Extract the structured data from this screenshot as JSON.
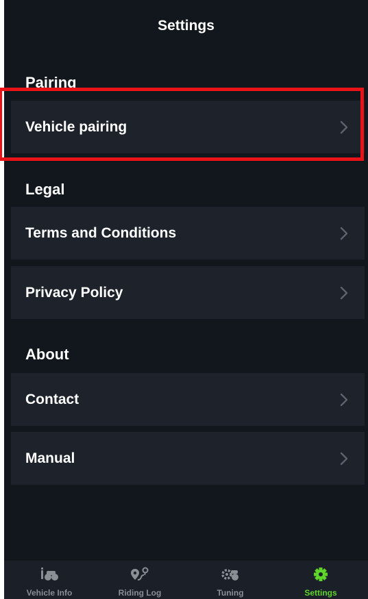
{
  "header": {
    "title": "Settings"
  },
  "sections": {
    "pairing": {
      "heading": "Pairing",
      "items": [
        {
          "label": "Vehicle pairing"
        }
      ]
    },
    "legal": {
      "heading": "Legal",
      "items": [
        {
          "label": "Terms and Conditions"
        },
        {
          "label": "Privacy Policy"
        }
      ]
    },
    "about": {
      "heading": "About",
      "items": [
        {
          "label": "Contact"
        },
        {
          "label": "Manual"
        }
      ]
    }
  },
  "tabbar": {
    "tabs": [
      {
        "label": "Vehicle Info",
        "icon": "motorcycle-info-icon",
        "active": false
      },
      {
        "label": "Riding Log",
        "icon": "route-pin-icon",
        "active": false
      },
      {
        "label": "Tuning",
        "icon": "motorcycle-gear-icon",
        "active": false
      },
      {
        "label": "Settings",
        "icon": "gear-icon",
        "active": true
      }
    ]
  },
  "colors": {
    "background": "#12171d",
    "row_background": "#1d222b",
    "text": "#ffffff",
    "chevron": "#5d636c",
    "tab_inactive": "#8a8f96",
    "tab_active": "#5fd42a",
    "highlight_border": "#ea1418"
  }
}
